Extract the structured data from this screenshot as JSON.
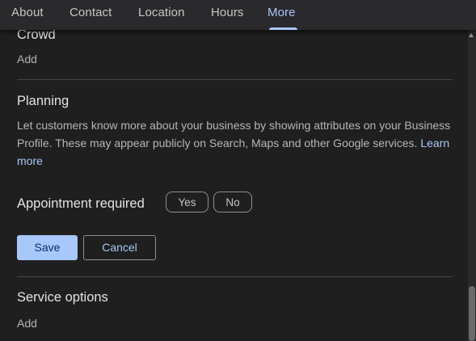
{
  "tabs": [
    {
      "label": "About"
    },
    {
      "label": "Contact"
    },
    {
      "label": "Location"
    },
    {
      "label": "Hours"
    },
    {
      "label": "More",
      "active": true
    }
  ],
  "crowd": {
    "title": "Crowd",
    "add_label": "Add"
  },
  "planning": {
    "title": "Planning",
    "description": "Let customers know more about your business by showing attributes on your Business Profile. These may appear publicly on Search, Maps and other Google services.",
    "learn_more": "Learn more",
    "attribute_label": "Appointment required",
    "options": {
      "yes": "Yes",
      "no": "No"
    },
    "save_label": "Save",
    "cancel_label": "Cancel"
  },
  "service_options": {
    "title": "Service options",
    "add_label": "Add"
  },
  "colors": {
    "accent": "#a8c7fa",
    "panel_bg": "#1f1f1f",
    "text_primary": "#e3e3e3",
    "text_secondary": "#b4b7b5"
  }
}
